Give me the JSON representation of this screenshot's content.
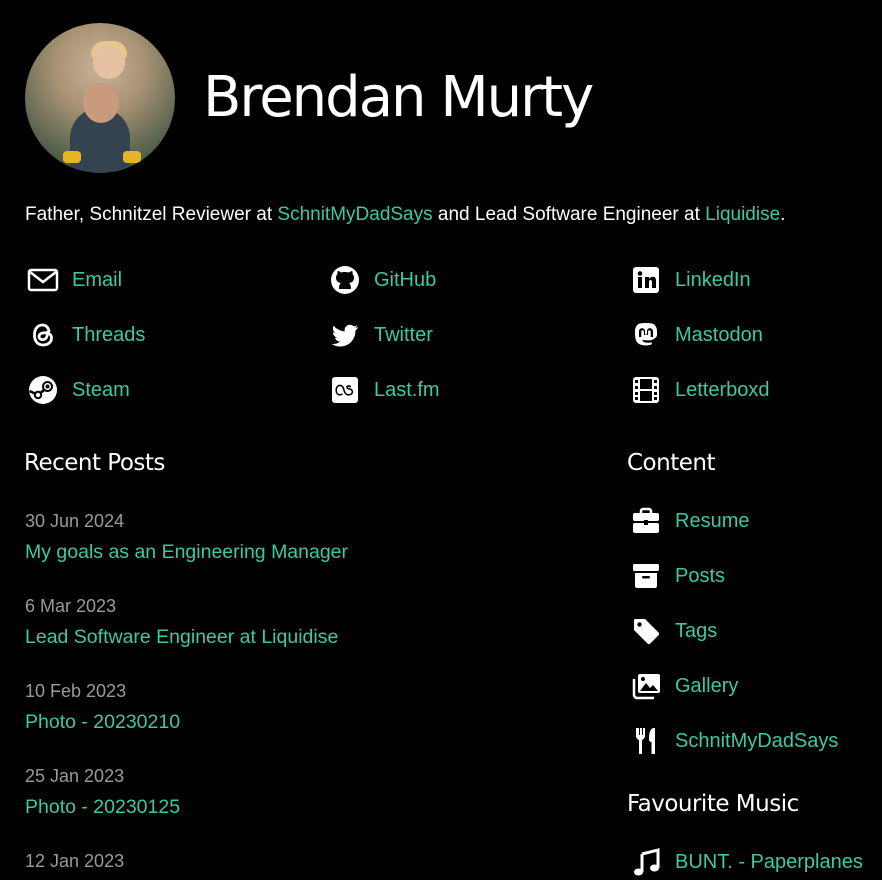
{
  "profile": {
    "name": "Brendan Murty",
    "bio_prefix": "Father, Schnitzel Reviewer at ",
    "bio_link1": "SchnitMyDadSays",
    "bio_middle": " and Lead Software Engineer at ",
    "bio_link2": "Liquidise",
    "bio_suffix": "."
  },
  "social": [
    {
      "label": "Email",
      "icon": "email-icon"
    },
    {
      "label": "GitHub",
      "icon": "github-icon"
    },
    {
      "label": "LinkedIn",
      "icon": "linkedin-icon"
    },
    {
      "label": "Threads",
      "icon": "threads-icon"
    },
    {
      "label": "Twitter",
      "icon": "twitter-icon"
    },
    {
      "label": "Mastodon",
      "icon": "mastodon-icon"
    },
    {
      "label": "Steam",
      "icon": "steam-icon"
    },
    {
      "label": "Last.fm",
      "icon": "lastfm-icon"
    },
    {
      "label": "Letterboxd",
      "icon": "film-icon"
    }
  ],
  "recent_posts": {
    "heading": "Recent Posts",
    "items": [
      {
        "date": "30 Jun 2024",
        "title": "My goals as an Engineering Manager"
      },
      {
        "date": "6 Mar 2023",
        "title": "Lead Software Engineer at Liquidise"
      },
      {
        "date": "10 Feb 2023",
        "title": "Photo - 20230210"
      },
      {
        "date": "25 Jan 2023",
        "title": "Photo - 20230125"
      },
      {
        "date": "12 Jan 2023",
        "title": ""
      }
    ]
  },
  "content": {
    "heading": "Content",
    "items": [
      {
        "label": "Resume",
        "icon": "briefcase-icon"
      },
      {
        "label": "Posts",
        "icon": "archive-icon"
      },
      {
        "label": "Tags",
        "icon": "tag-icon"
      },
      {
        "label": "Gallery",
        "icon": "gallery-icon"
      },
      {
        "label": "SchnitMyDadSays",
        "icon": "utensils-icon"
      }
    ]
  },
  "music": {
    "heading": "Favourite Music",
    "items": [
      {
        "label": "BUNT. - Paperplanes",
        "icon": "music-note-icon"
      }
    ]
  },
  "colors": {
    "background": "#000000",
    "accent": "#3ec8a6",
    "date": "#9a9a9a",
    "text": "#ffffff"
  }
}
